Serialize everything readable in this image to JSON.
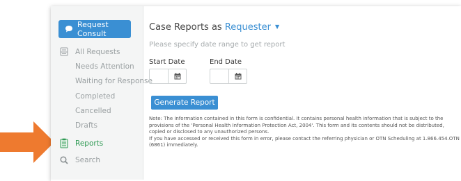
{
  "sidebar": {
    "consult_button": "Request Consult",
    "all_requests": "All Requests",
    "sub_items": [
      {
        "label": "Needs Attention"
      },
      {
        "label": "Waiting for Response"
      },
      {
        "label": "Completed"
      },
      {
        "label": "Cancelled"
      },
      {
        "label": "Drafts"
      }
    ],
    "reports": "Reports",
    "search": "Search"
  },
  "main": {
    "title_prefix": "Case Reports as",
    "role": "Requester",
    "hint": "Please specify date range to get report",
    "start_date_label": "Start Date",
    "start_date_value": "",
    "end_date_label": "End Date",
    "end_date_value": "",
    "generate_button": "Generate Report",
    "note_line1": "Note: The information contained in this form is confidential. It contains personal health information that is subject to the provisions of the 'Personal Health Information Protection Act, 2004'. This form and its contents should not be distributed, copied or disclosed to any unauthorized persons.",
    "note_line2": "If you have accessed or received this form in error, please contact the referring physician or OTN Scheduling at 1.866.454.OTN (6861) immediately."
  },
  "colors": {
    "accent": "#3a8fd3",
    "active": "#2f9a54",
    "arrow": "#ee7a2f"
  },
  "icons": {
    "consult": "chat-bubble-icon",
    "all_requests": "inbox-icon",
    "reports": "clipboard-icon",
    "search": "search-icon",
    "date": "calendar-icon",
    "role_dropdown": "caret-down-icon",
    "pointer": "arrow-right-icon"
  }
}
